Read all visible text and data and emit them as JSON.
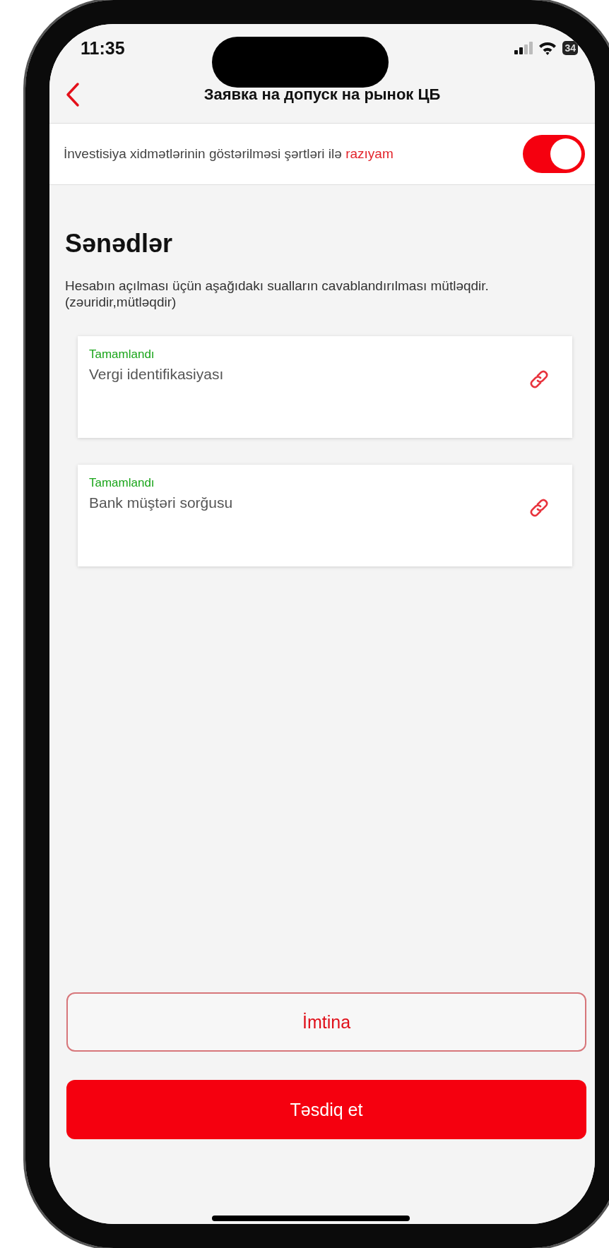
{
  "status_bar": {
    "time": "11:35",
    "battery": "34"
  },
  "header": {
    "title": "Заявка на допуск на рынок ЦБ"
  },
  "agreement": {
    "text": "İnvestisiya xidmətlərinin göstərilməsi şərtləri ilə",
    "link": "razıyam",
    "on": true
  },
  "section": {
    "title": "Sənədlər",
    "description": "Hesabın açılması üçün aşağıdakı sualların cavablandırılması mütləqdir. (zəuridir,mütləqdir)"
  },
  "documents": [
    {
      "status": "Tamamlandı",
      "title": "Vergi identifikasiyası"
    },
    {
      "status": "Tamamlandı",
      "title": "Bank müştəri sorğusu"
    }
  ],
  "buttons": [
    {
      "label": "İmtina",
      "kind": "outline"
    },
    {
      "label": "Təsdiq et",
      "kind": "primary"
    }
  ]
}
